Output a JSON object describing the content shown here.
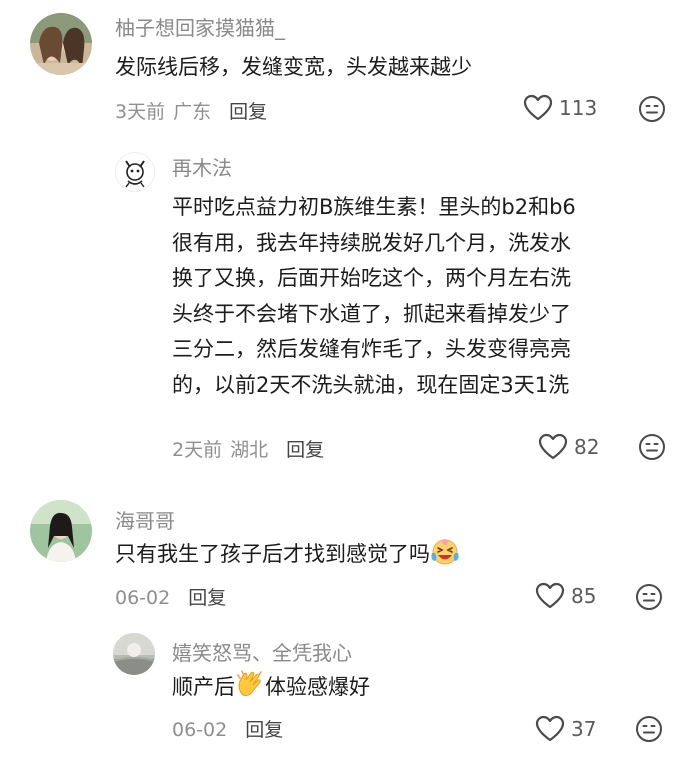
{
  "comments": [
    {
      "username": "柚子想回家摸猫猫_",
      "text_lines": [
        "发际线后移，发缝变宽，头发越来越少"
      ],
      "time": "3天前",
      "location": "广东",
      "reply_label": "回复",
      "likes": "113"
    },
    {
      "username": "再木法",
      "text_lines": [
        "平时吃点益力初B族维生素！里头的b2和b6",
        "很有用，我去年持续脱发好几个月，洗发水",
        "换了又换，后面开始吃这个，两个月左右洗",
        "头终于不会堵下水道了，抓起来看掉发少了",
        "三分二，然后发缝有炸毛了，头发变得亮亮",
        "的，以前2天不洗头就油，现在固定3天1洗"
      ],
      "time": "2天前",
      "location": "湖北",
      "reply_label": "回复",
      "likes": "82"
    },
    {
      "username": "海哥哥",
      "text_lines": [
        "只有我生了孩子后才找到感觉了吗"
      ],
      "text_emoji": "laughing-tears-emoji",
      "time": "06-02",
      "reply_label": "回复",
      "likes": "85"
    },
    {
      "username": "嬉笑怒骂、全凭我心",
      "text_before": "顺产后",
      "text_emoji": "clapping-hands-emoji",
      "text_after": "体验感爆好",
      "time": "06-02",
      "reply_label": "回复",
      "likes": "37"
    }
  ],
  "colors": {
    "username": "#8a8a8a",
    "text": "#1c1c1c",
    "meta": "#8f8f8f",
    "icon": "#4a4a4a"
  }
}
